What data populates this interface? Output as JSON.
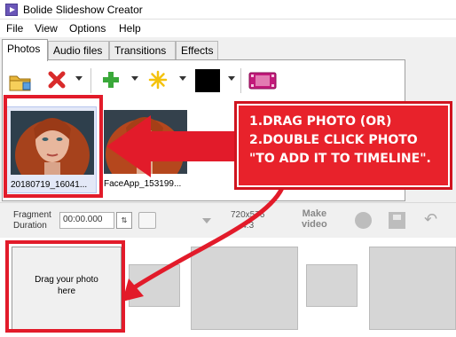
{
  "window": {
    "title": "Bolide Slideshow Creator"
  },
  "menu": [
    "File",
    "View",
    "Options",
    "Help"
  ],
  "tabs": [
    "Photos",
    "Audio files",
    "Transitions",
    "Effects"
  ],
  "photos": [
    {
      "label": "20180719_16041...",
      "selected": true
    },
    {
      "label": "FaceApp_153199...",
      "selected": false
    }
  ],
  "fragment": {
    "label_line1": "Fragment",
    "label_line2": "Duration",
    "duration_placeholder": "00:00.000",
    "resolution_line1": "720x576",
    "resolution_line2": "4:3",
    "make_video_line1": "Make",
    "make_video_line2": "video"
  },
  "timeline": {
    "drop_hint_line1": "Drag your photo",
    "drop_hint_line2": "here"
  },
  "annotation": {
    "line1": "1.DRAG PHOTO (OR)",
    "line2": "2.DOUBLE CLICK PHOTO",
    "line3": "\"TO ADD IT TO TIMELINE\"."
  },
  "colors": {
    "annotation_red": "#e21b2a",
    "slot_gray": "#d6d6d6",
    "selection": "#e3e8f7"
  }
}
